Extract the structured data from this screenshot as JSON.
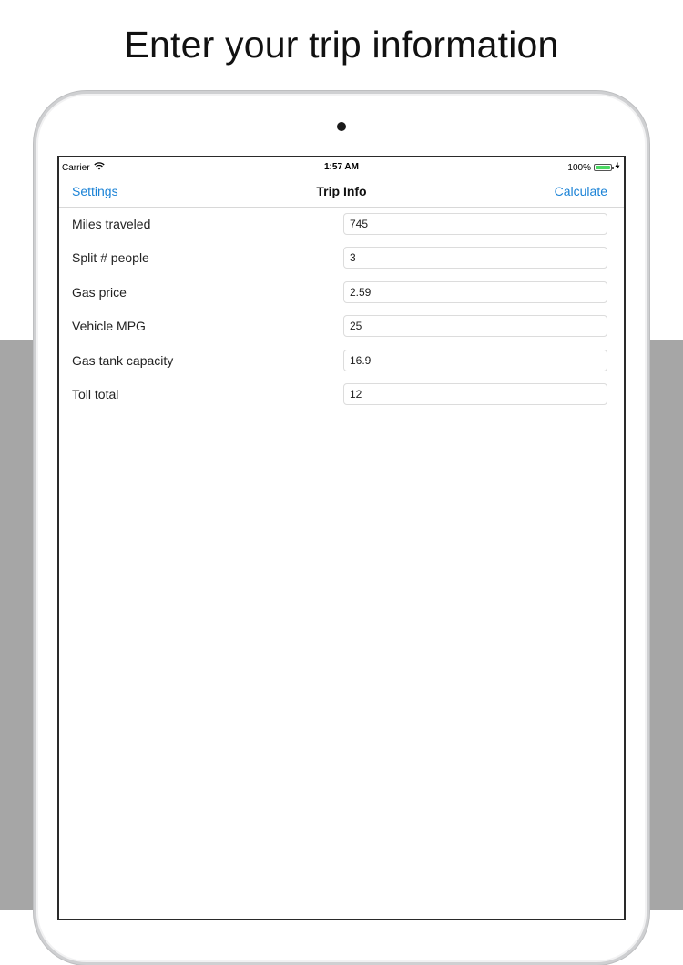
{
  "headline": "Enter your trip information",
  "status_bar": {
    "carrier": "Carrier",
    "time": "1:57 AM",
    "battery": "100%"
  },
  "nav": {
    "left_button": "Settings",
    "title": "Trip Info",
    "right_button": "Calculate"
  },
  "fields": [
    {
      "label": "Miles traveled",
      "value": "745"
    },
    {
      "label": "Split # people",
      "value": "3"
    },
    {
      "label": "Gas price",
      "value": "2.59"
    },
    {
      "label": "Vehicle MPG",
      "value": "25"
    },
    {
      "label": "Gas tank capacity",
      "value": "16.9"
    },
    {
      "label": "Toll total",
      "value": "12"
    }
  ],
  "colors": {
    "accent": "#1a82d6",
    "battery": "#4cd964",
    "background_band": "#a6a6a6"
  }
}
